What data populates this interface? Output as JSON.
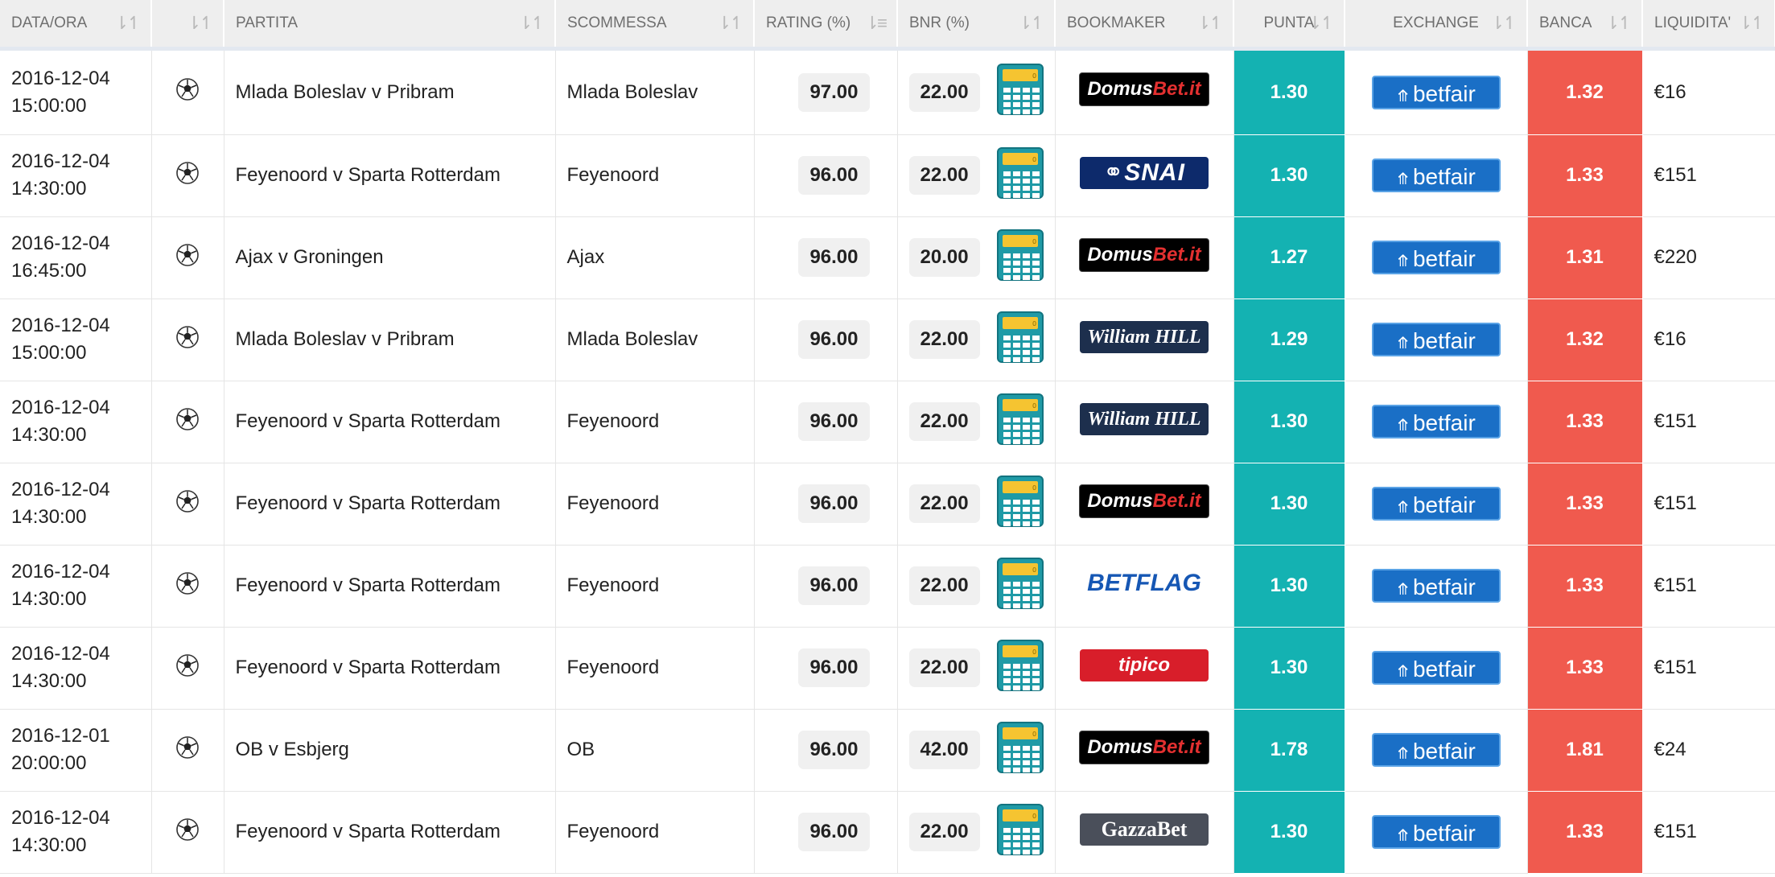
{
  "table": {
    "headers": [
      {
        "label": "DATA/ORA",
        "sort": "⇂↿"
      },
      {
        "label": "",
        "sort": "⇂↿"
      },
      {
        "label": "PARTITA",
        "sort": "⇂↿"
      },
      {
        "label": "SCOMMESSA",
        "sort": "⇂↿"
      },
      {
        "label": "RATING (%)",
        "sort": "⇂≡"
      },
      {
        "label": "BNR (%)",
        "sort": "⇂↿"
      },
      {
        "label": "BOOKMAKER",
        "sort": "⇂↿"
      },
      {
        "label": "PUNTA",
        "sort": "⇂↿"
      },
      {
        "label": "EXCHANGE",
        "sort": "⇂↿"
      },
      {
        "label": "BANCA",
        "sort": "⇂↿"
      },
      {
        "label": "LIQUIDITA'",
        "sort": "⇂↿"
      }
    ],
    "rows": [
      {
        "date": "2016-12-04",
        "time": "15:00:00",
        "sport_icon": "⚽",
        "match": "Mlada Boleslav v Pribram",
        "bet": "Mlada Boleslav",
        "rating": "97.00",
        "bnr": "22.00",
        "bookmaker": "DomusBet",
        "punta": "1.30",
        "exchange": "betfair",
        "banca": "1.32",
        "liquidity": "€16"
      },
      {
        "date": "2016-12-04",
        "time": "14:30:00",
        "sport_icon": "⚽",
        "match": "Feyenoord v Sparta Rotterdam",
        "bet": "Feyenoord",
        "rating": "96.00",
        "bnr": "22.00",
        "bookmaker": "SNAI",
        "punta": "1.30",
        "exchange": "betfair",
        "banca": "1.33",
        "liquidity": "€151"
      },
      {
        "date": "2016-12-04",
        "time": "16:45:00",
        "sport_icon": "⚽",
        "match": "Ajax v Groningen",
        "bet": "Ajax",
        "rating": "96.00",
        "bnr": "20.00",
        "bookmaker": "DomusBet",
        "punta": "1.27",
        "exchange": "betfair",
        "banca": "1.31",
        "liquidity": "€220"
      },
      {
        "date": "2016-12-04",
        "time": "15:00:00",
        "sport_icon": "⚽",
        "match": "Mlada Boleslav v Pribram",
        "bet": "Mlada Boleslav",
        "rating": "96.00",
        "bnr": "22.00",
        "bookmaker": "WilliamHILL",
        "punta": "1.29",
        "exchange": "betfair",
        "banca": "1.32",
        "liquidity": "€16"
      },
      {
        "date": "2016-12-04",
        "time": "14:30:00",
        "sport_icon": "⚽",
        "match": "Feyenoord v Sparta Rotterdam",
        "bet": "Feyenoord",
        "rating": "96.00",
        "bnr": "22.00",
        "bookmaker": "WilliamHILL",
        "punta": "1.30",
        "exchange": "betfair",
        "banca": "1.33",
        "liquidity": "€151"
      },
      {
        "date": "2016-12-04",
        "time": "14:30:00",
        "sport_icon": "⚽",
        "match": "Feyenoord v Sparta Rotterdam",
        "bet": "Feyenoord",
        "rating": "96.00",
        "bnr": "22.00",
        "bookmaker": "DomusBet",
        "punta": "1.30",
        "exchange": "betfair",
        "banca": "1.33",
        "liquidity": "€151"
      },
      {
        "date": "2016-12-04",
        "time": "14:30:00",
        "sport_icon": "⚽",
        "match": "Feyenoord v Sparta Rotterdam",
        "bet": "Feyenoord",
        "rating": "96.00",
        "bnr": "22.00",
        "bookmaker": "BETFLAG",
        "punta": "1.30",
        "exchange": "betfair",
        "banca": "1.33",
        "liquidity": "€151"
      },
      {
        "date": "2016-12-04",
        "time": "14:30:00",
        "sport_icon": "⚽",
        "match": "Feyenoord v Sparta Rotterdam",
        "bet": "Feyenoord",
        "rating": "96.00",
        "bnr": "22.00",
        "bookmaker": "tipico",
        "punta": "1.30",
        "exchange": "betfair",
        "banca": "1.33",
        "liquidity": "€151"
      },
      {
        "date": "2016-12-01",
        "time": "20:00:00",
        "sport_icon": "⚽",
        "match": "OB v Esbjerg",
        "bet": "OB",
        "rating": "96.00",
        "bnr": "42.00",
        "bookmaker": "DomusBet",
        "punta": "1.78",
        "exchange": "betfair",
        "banca": "1.81",
        "liquidity": "€24"
      },
      {
        "date": "2016-12-04",
        "time": "14:30:00",
        "sport_icon": "⚽",
        "match": "Feyenoord v Sparta Rotterdam",
        "bet": "Feyenoord",
        "rating": "96.00",
        "bnr": "22.00",
        "bookmaker": "GazzaBet",
        "punta": "1.30",
        "exchange": "betfair",
        "banca": "1.33",
        "liquidity": "€151"
      }
    ]
  },
  "colors": {
    "punta": "#14b2b2",
    "banca": "#f05a4e",
    "header": "#eeeeee",
    "betfair": "#1a6fc6"
  },
  "icons": {
    "sport": "soccer-ball-icon",
    "calculator": "calculator-icon",
    "sort": "sort-arrows-icon"
  }
}
